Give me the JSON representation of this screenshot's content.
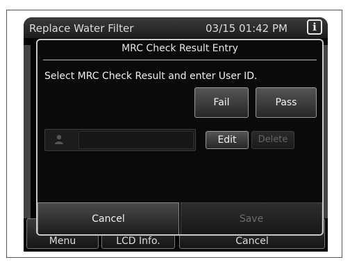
{
  "screen": {
    "title": "Replace Water Filter",
    "datetime": "03/15 01:42 PM",
    "info_icon": "i"
  },
  "bottom_nav": {
    "items": [
      {
        "label": "Menu"
      },
      {
        "label": "LCD Info."
      },
      {
        "label": "Cancel"
      }
    ]
  },
  "dialog": {
    "title": "MRC Check Result Entry",
    "instruction": "Select MRC Check Result and enter User ID.",
    "fail_label": "Fail",
    "pass_label": "Pass",
    "user_id_value": "",
    "edit_label": "Edit",
    "delete_label": "Delete",
    "cancel_label": "Cancel",
    "save_label": "Save"
  }
}
